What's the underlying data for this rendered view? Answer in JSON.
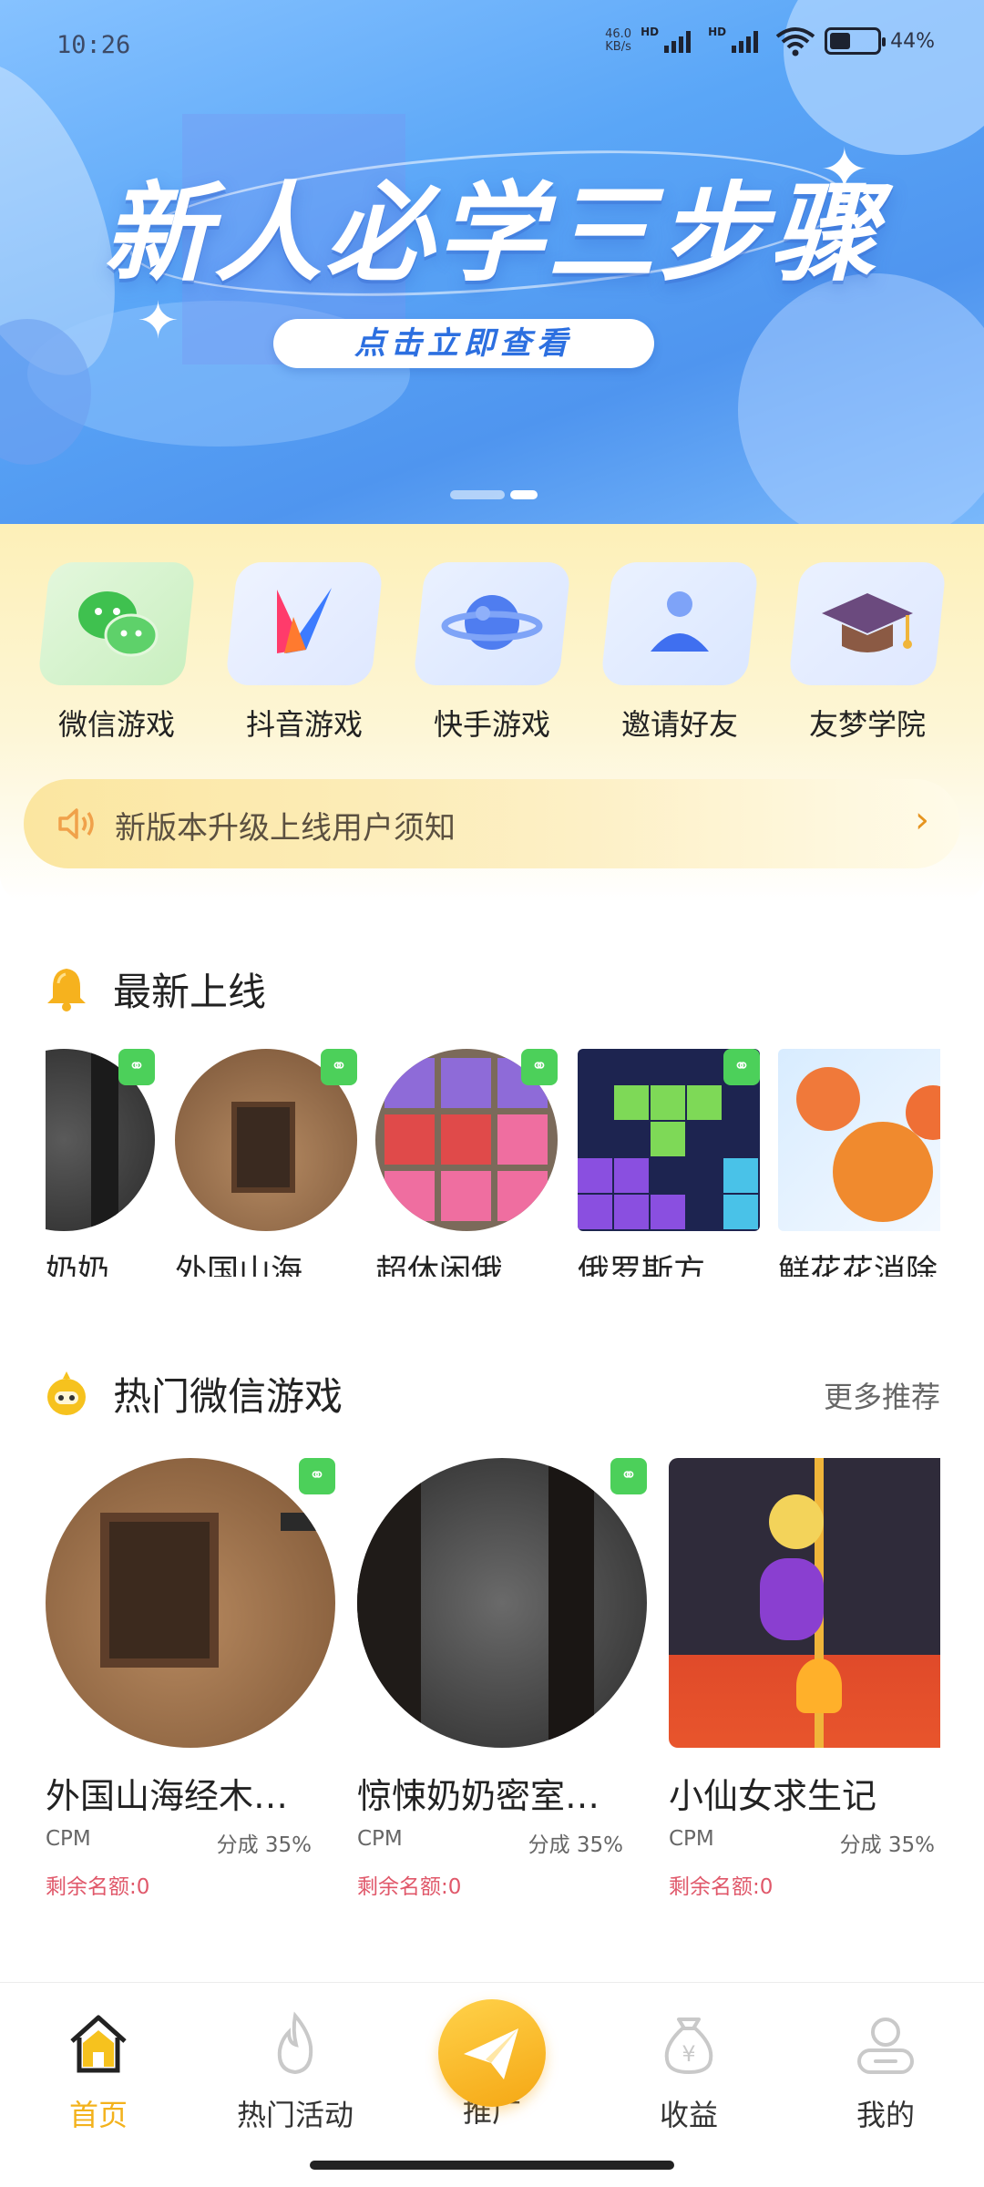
{
  "status_bar": {
    "time": "10:26",
    "net_speed_top": "46.0",
    "net_speed_bottom": "KB/s",
    "hd1": "HD",
    "hd2": "HD",
    "battery_percent": "44",
    "battery_label": "44%"
  },
  "banner": {
    "title": "新人必学三步骤",
    "cta": "点击立即查看",
    "slide_count": 2,
    "active_slide": 2
  },
  "quick_menu": [
    {
      "label": "微信游戏",
      "icon": "wechat-icon"
    },
    {
      "label": "抖音游戏",
      "icon": "douyin-icon"
    },
    {
      "label": "快手游戏",
      "icon": "kuaishou-planet-icon"
    },
    {
      "label": "邀请好友",
      "icon": "invite-user-icon"
    },
    {
      "label": "友梦学院",
      "icon": "graduation-cap-icon"
    }
  ],
  "notice": {
    "text": "新版本升级上线用户须知",
    "icon": "speaker-icon",
    "arrow": "›"
  },
  "latest": {
    "title": "最新上线",
    "icon": "bell-icon",
    "items": [
      {
        "title": "奶奶…"
      },
      {
        "title": "外国山海…"
      },
      {
        "title": "超休闲俄…"
      },
      {
        "title": "俄罗斯方…"
      },
      {
        "title": "鲜花花消除"
      }
    ]
  },
  "hot_wechat": {
    "title": "热门微信游戏",
    "more": "更多推荐",
    "icon": "mascot-icon",
    "items": [
      {
        "title": "外国山海经木…",
        "metric": "CPM",
        "share": "分成 35%",
        "remain": "剩余名额:0"
      },
      {
        "title": "惊悚奶奶密室…",
        "metric": "CPM",
        "share": "分成 35%",
        "remain": "剩余名额:0"
      },
      {
        "title": "小仙女求生记",
        "metric": "CPM",
        "share": "分成 35%",
        "remain": "剩余名额:0"
      }
    ]
  },
  "tabbar": [
    {
      "label": "首页",
      "icon": "home-icon",
      "active": true
    },
    {
      "label": "热门活动",
      "icon": "flame-icon",
      "active": false
    },
    {
      "label": "推广",
      "icon": "paper-plane-icon",
      "active": false
    },
    {
      "label": "收益",
      "icon": "money-bag-icon",
      "active": false
    },
    {
      "label": "我的",
      "icon": "profile-icon",
      "active": false
    }
  ],
  "colors": {
    "accent": "#f3b21c",
    "remain_red": "#e0586a",
    "banner_blue": "#5aa6f7",
    "badge_green": "#4cd05a"
  }
}
